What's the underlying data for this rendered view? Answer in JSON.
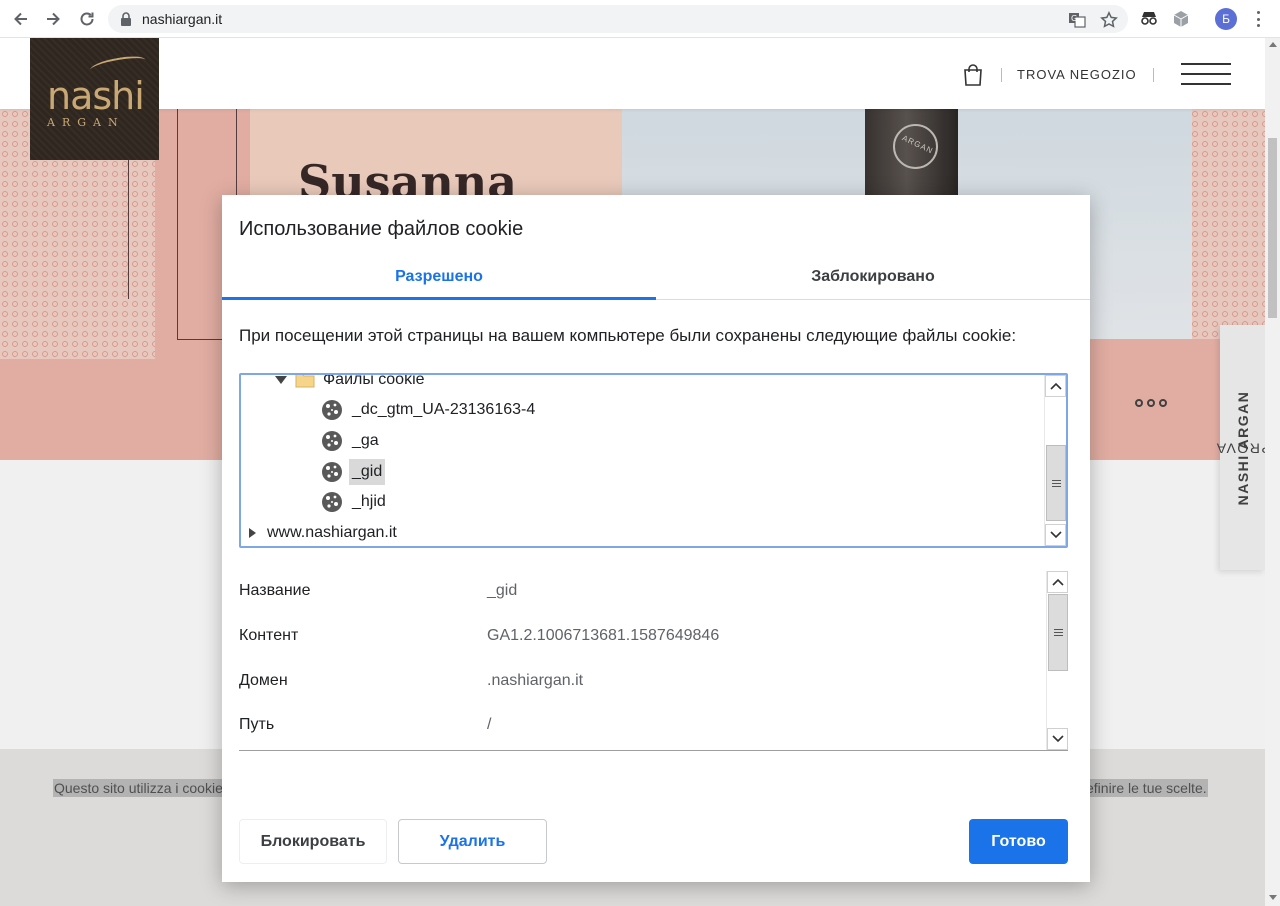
{
  "browser": {
    "url": "nashiargan.it",
    "profile_initial": "Б"
  },
  "site": {
    "logo_main": "nashi",
    "logo_sub": "ARGAN",
    "find_store": "TROVA NEGOZIO",
    "hero_title": "Susanna",
    "bottle_text": "ARGAN",
    "side_tab_prefix": "PROVA ",
    "side_tab_brand": "NASHI ARGAN",
    "cookie_bar_left": "Questo sito utilizza i cookie",
    "cookie_bar_right": "efinire le tue scelte."
  },
  "dialog": {
    "title": "Использование файлов cookie",
    "tabs": [
      {
        "label": "Разрешено",
        "active": true
      },
      {
        "label": "Заблокировано",
        "active": false
      }
    ],
    "description": "При посещении этой страницы на вашем компьютере были сохранены следующие файлы cookie:",
    "tree": {
      "folder": "Файлы cookie",
      "cookies": [
        "_dc_gtm_UA-23136163-4",
        "_ga",
        "_gid",
        "_hjid"
      ],
      "selected": "_gid",
      "domain": "www.nashiargan.it"
    },
    "details": [
      {
        "key": "Название",
        "value": "_gid"
      },
      {
        "key": "Контент",
        "value": "GA1.2.1006713681.1587649846"
      },
      {
        "key": "Домен",
        "value": ".nashiargan.it"
      },
      {
        "key": "Путь",
        "value": "/"
      }
    ],
    "buttons": {
      "block": "Блокировать",
      "delete": "Удалить",
      "done": "Готово"
    }
  },
  "colors": {
    "accent": "#1a73e8",
    "hero_pink": "#f0b8ad",
    "logo_bg": "#2f2620",
    "logo_gold": "#c9a874"
  }
}
